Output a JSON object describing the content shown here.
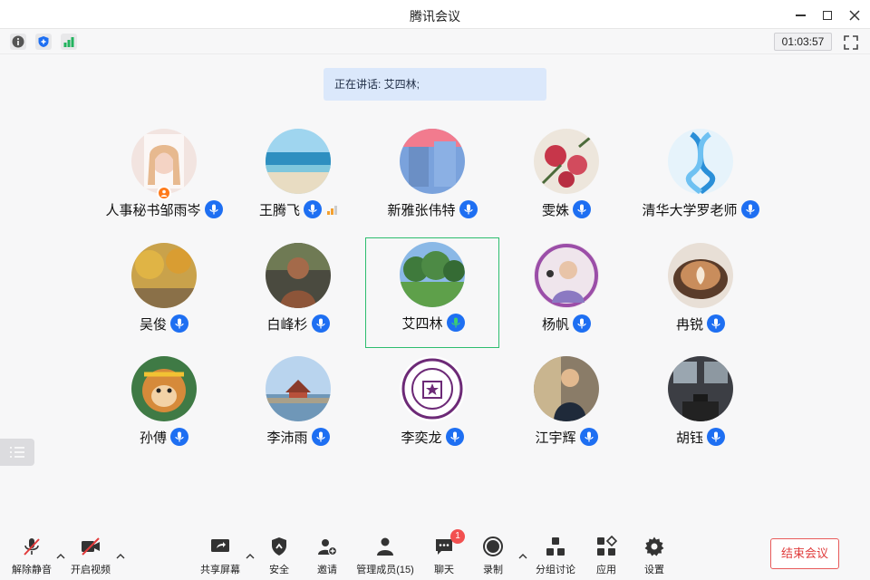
{
  "window": {
    "title": "腾讯会议"
  },
  "status": {
    "timer": "01:03:57",
    "icons": [
      "info-icon",
      "shield-icon",
      "signal-icon",
      "fullscreen-icon"
    ]
  },
  "speaking": {
    "text": "正在讲话: 艾四林;"
  },
  "participants": [
    {
      "name": "人事秘书邹雨岑",
      "host": true
    },
    {
      "name": "王腾飞",
      "signal": "weak"
    },
    {
      "name": "新雅张伟特"
    },
    {
      "name": "雯姝"
    },
    {
      "name": "清华大学罗老师"
    },
    {
      "name": "吴俊"
    },
    {
      "name": "白峰杉"
    },
    {
      "name": "艾四林",
      "speaking": true
    },
    {
      "name": "杨帆"
    },
    {
      "name": "冉锐"
    },
    {
      "name": "孙傅"
    },
    {
      "name": "李沛雨"
    },
    {
      "name": "李奕龙"
    },
    {
      "name": "江宇辉"
    },
    {
      "name": "胡钰"
    }
  ],
  "toolbar": {
    "unmute": "解除静音",
    "start_video": "开启视频",
    "share_screen": "共享屏幕",
    "security": "安全",
    "invite": "邀请",
    "manage_members": "管理成员(15)",
    "chat": "聊天",
    "chat_badge": "1",
    "record": "录制",
    "breakout": "分组讨论",
    "apps": "应用",
    "settings": "设置",
    "end_meeting": "结束会议"
  },
  "colors": {
    "accent": "#1e6ff2",
    "speaking_border": "#2dbd6e",
    "end_red": "#e03c3c",
    "banner": "#dbe8fb"
  }
}
